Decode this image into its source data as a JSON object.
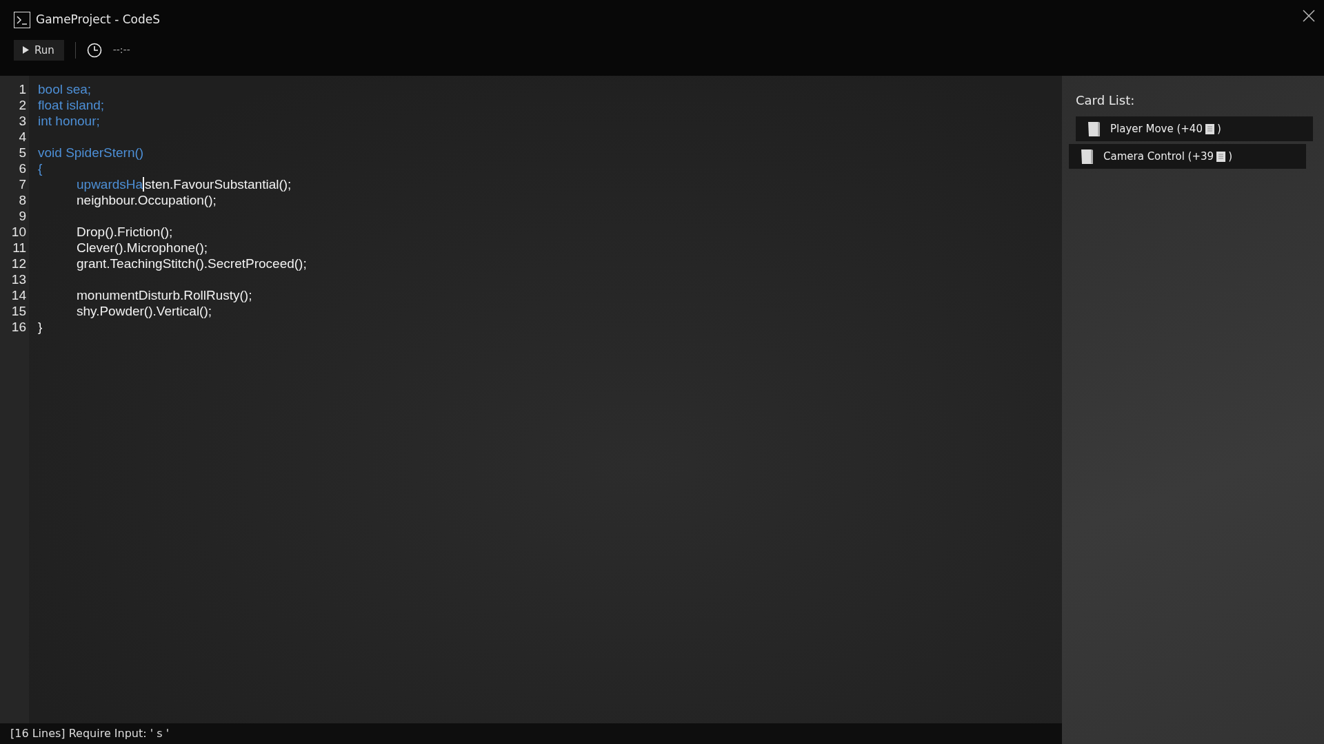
{
  "window": {
    "title": "GameProject - CodeS"
  },
  "toolbar": {
    "run_label": "Run",
    "timer": "--:--"
  },
  "editor": {
    "lines": [
      {
        "number": "1",
        "indented": false,
        "segments": [
          {
            "text": "bool sea;",
            "kind": "typed"
          }
        ]
      },
      {
        "number": "2",
        "indented": false,
        "segments": [
          {
            "text": "float island;",
            "kind": "typed"
          }
        ]
      },
      {
        "number": "3",
        "indented": false,
        "segments": [
          {
            "text": "int honour;",
            "kind": "typed"
          }
        ]
      },
      {
        "number": "4"
      },
      {
        "number": "5",
        "indented": false,
        "segments": [
          {
            "text": "void SpiderStern()",
            "kind": "typed"
          }
        ]
      },
      {
        "number": "6",
        "indented": false,
        "segments": [
          {
            "text": "{",
            "kind": "typed"
          }
        ]
      },
      {
        "number": "7",
        "indented": true,
        "cursor": true,
        "segments": [
          {
            "text": "upwardsHa",
            "kind": "typed"
          },
          {
            "text": "sten.FavourSubstantial();",
            "kind": "pending"
          }
        ]
      },
      {
        "number": "8",
        "indented": true,
        "segments": [
          {
            "text": "neighbour.Occupation();",
            "kind": "pending"
          }
        ]
      },
      {
        "number": "9"
      },
      {
        "number": "10",
        "indented": true,
        "segments": [
          {
            "text": "Drop().Friction();",
            "kind": "pending"
          }
        ]
      },
      {
        "number": "11",
        "indented": true,
        "segments": [
          {
            "text": "Clever().Microphone();",
            "kind": "pending"
          }
        ]
      },
      {
        "number": "12",
        "indented": true,
        "segments": [
          {
            "text": "grant.TeachingStitch().SecretProceed();",
            "kind": "pending"
          }
        ]
      },
      {
        "number": "13"
      },
      {
        "number": "14",
        "indented": true,
        "segments": [
          {
            "text": "monumentDisturb.RollRusty();",
            "kind": "pending"
          }
        ]
      },
      {
        "number": "15",
        "indented": true,
        "segments": [
          {
            "text": "shy.Powder().Vertical();",
            "kind": "pending"
          }
        ]
      },
      {
        "number": "16",
        "indented": false,
        "segments": [
          {
            "text": "}",
            "kind": "pending"
          }
        ]
      }
    ]
  },
  "status_bar": {
    "text": "[16 Lines] Require Input: ' s '"
  },
  "card_list": {
    "title": "Card List:",
    "cards": [
      {
        "name": "Player Move (+40",
        "close": ")"
      },
      {
        "name": "Camera Control (+39",
        "close": ")"
      }
    ]
  }
}
